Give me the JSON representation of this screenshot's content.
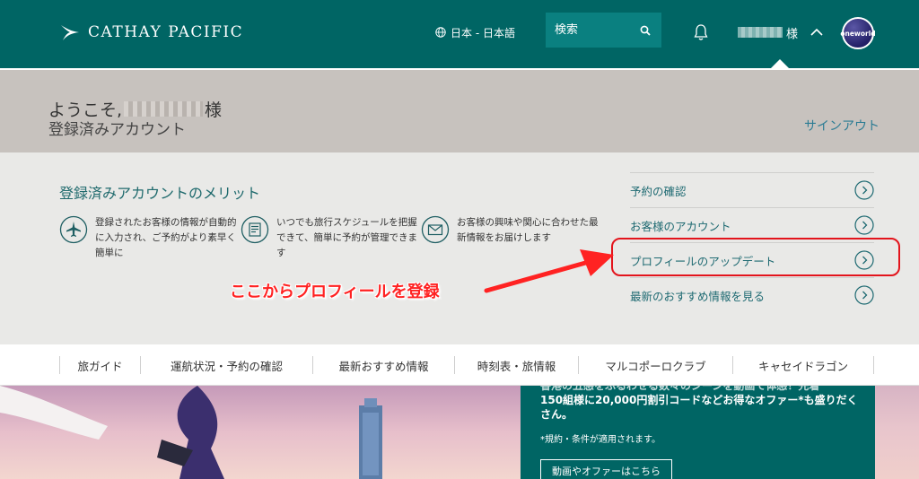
{
  "header": {
    "brand": "CATHAY PACIFIC",
    "language": "日本 - 日本語",
    "search_placeholder": "検索",
    "user_suffix": "様",
    "oneworld": "oneworld"
  },
  "welcome": {
    "greeting_prefix": "ようこそ,",
    "greeting_suffix": "様",
    "account_type": "登録済みアカウント",
    "signout": "サインアウト"
  },
  "benefits": {
    "title": "登録済みアカウントのメリット",
    "features": [
      {
        "icon": "airplane-icon",
        "text": "登録されたお客様の情報が自動的に入力され、ご予約がより素早く簡単に"
      },
      {
        "icon": "checklist-icon",
        "text": "いつでも旅行スケジュールを把握できて、簡単に予約が管理できます"
      },
      {
        "icon": "envelope-icon",
        "text": "お客様の興味や関心に合わせた最新情報をお届けします"
      }
    ]
  },
  "account_links": [
    {
      "label": "予約の確認"
    },
    {
      "label": "お客様のアカウント"
    },
    {
      "label": "プロフィールのアップデート"
    },
    {
      "label": "最新のおすすめ情報を見る"
    }
  ],
  "annotation": {
    "text": "ここからプロフィールを登録"
  },
  "nav": [
    {
      "label": "旅ガイド"
    },
    {
      "label": "運航状況・予約の確認"
    },
    {
      "label": "最新おすすめ情報"
    },
    {
      "label": "時刻表・旅情報"
    },
    {
      "label": "マルコポーロクラブ"
    },
    {
      "label": "キャセイドラゴン"
    }
  ],
  "promo": {
    "text": "150組様に20,000円割引コードなどお得なオファー*も盛りだくさん。",
    "clipped_text": "香港の五感をふるわせる数々のシーンを動画で体感！先着",
    "note": "*規約・条件が適用されます。",
    "button": "動画やオファーはこちら"
  },
  "colors": {
    "brand_teal": "#006564",
    "welcome_gray": "#c7c2be",
    "panel_gray": "#e9e9e7",
    "link_teal": "#1e6a72",
    "annotation_red": "#ff2222"
  }
}
